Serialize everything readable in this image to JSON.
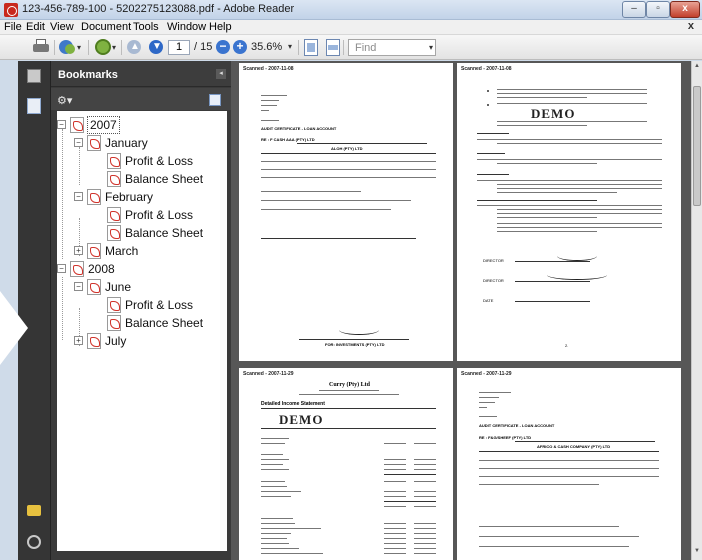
{
  "window": {
    "title": "123-456-789-100 - 5202275123088.pdf - Adobe Reader",
    "controls": {
      "minimize": "–",
      "maximize": "▫",
      "close": "x"
    }
  },
  "menu": [
    "File",
    "Edit",
    "View",
    "Document",
    "Tools",
    "Window",
    "Help"
  ],
  "menu_close": "x",
  "toolbar": {
    "current_page": "1",
    "total_pages": "/ 15",
    "zoom": "35.6%",
    "find_placeholder": "Find"
  },
  "panel": {
    "title": "Bookmarks",
    "collapse": "◂",
    "options": "⚙▾"
  },
  "bookmarks": [
    {
      "label": "2007",
      "level": 0,
      "expanded": true
    },
    {
      "label": "January",
      "level": 1,
      "expanded": true
    },
    {
      "label": "Profit & Loss",
      "level": 2
    },
    {
      "label": "Balance Sheet",
      "level": 2
    },
    {
      "label": "February",
      "level": 1,
      "expanded": true
    },
    {
      "label": "Profit & Loss",
      "level": 2
    },
    {
      "label": "Balance Sheet",
      "level": 2
    },
    {
      "label": "March",
      "level": 1,
      "expanded": false
    },
    {
      "label": "2008",
      "level": 0,
      "expanded": true
    },
    {
      "label": "June",
      "level": 1,
      "expanded": true
    },
    {
      "label": "Profit & Loss",
      "level": 2
    },
    {
      "label": "Balance Sheet",
      "level": 2
    },
    {
      "label": "July",
      "level": 1,
      "expanded": false
    }
  ],
  "pages": {
    "p1": {
      "scan": "Scanned - 2007-11-08",
      "heading": "AUDIT CERTIFICATE - LOAN ACCOUNT",
      "re": "RE : F CASH AAA (PTY) LTD",
      "company": "ALOH (PTY) LTD",
      "footer": "FOR: INVESTMENTS (PTY) LTD"
    },
    "p2": {
      "scan": "Scanned - 2007-11-08",
      "stamp": "DEMO",
      "directors": [
        "DIRECTOR",
        "DIRECTOR",
        "DATE"
      ],
      "page_no": "2."
    },
    "p3": {
      "scan": "Scanned - 2007-11-29",
      "company": "Curry (Pty) Ltd",
      "subtitle": "Detailed Income Statement",
      "stamp": "DEMO"
    },
    "p4": {
      "scan": "Scanned - 2007-11-29",
      "heading": "AUDIT CERTIFICATE - LOAN ACCOUNT",
      "re": "RE : F&G/SHEEF (PTY) LTD",
      "company": "AFRICO & CASH COMPANY (PTY) LTD"
    }
  }
}
